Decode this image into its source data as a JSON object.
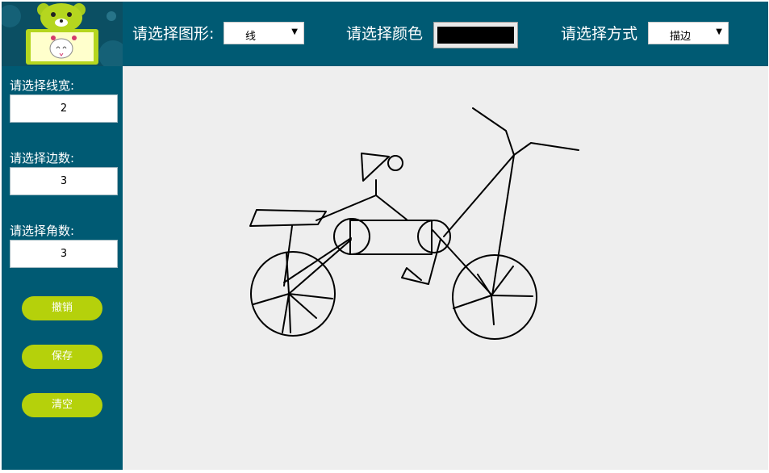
{
  "toolbar": {
    "shape_label": "请选择图形:",
    "shape_value": "线",
    "color_label": "请选择颜色",
    "color_value": "#000000",
    "mode_label": "请选择方式",
    "mode_value": "描边"
  },
  "sidebar": {
    "line_width_label": "请选择线宽:",
    "line_width_value": "2",
    "sides_label": "请选择边数:",
    "sides_value": "3",
    "angles_label": "请选择角数:",
    "angles_value": "3",
    "undo_label": "撤销",
    "save_label": "保存",
    "clear_label": "清空"
  },
  "colors": {
    "header_bg": "#005a73",
    "canvas_bg": "#eeeeee",
    "button_bg": "#b5d10b",
    "stroke": "#000000"
  }
}
